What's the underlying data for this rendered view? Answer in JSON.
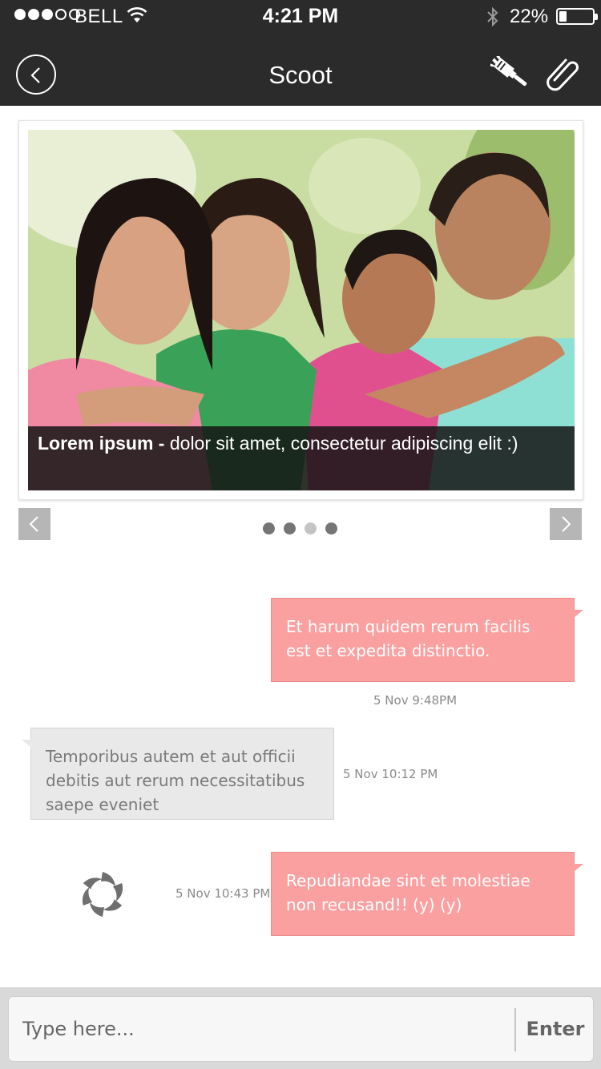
{
  "status_bar": {
    "carrier": "BELL",
    "time": "4:21 PM",
    "battery_percent": "22%",
    "battery_level": 0.22,
    "signal_bars_filled": 3,
    "signal_bars_total": 5,
    "icons": [
      "wifi-icon",
      "bluetooth-icon",
      "battery-icon"
    ]
  },
  "nav": {
    "title": "Scoot",
    "icons": [
      "back-icon",
      "brush-icon",
      "paperclip-icon"
    ]
  },
  "carousel": {
    "caption_bold": "Lorem ipsum -",
    "caption_text": " dolor sit amet, consectetur adipiscing elit :)",
    "pages_total": 4,
    "active_page": 3,
    "icons": [
      "chevron-left-icon",
      "chevron-right-icon"
    ]
  },
  "messages": [
    {
      "direction": "out",
      "text": "Et harum quidem rerum facilis est et expedita distinctio.",
      "timestamp": "5 Nov 9:48PM"
    },
    {
      "direction": "in",
      "text": "Temporibus autem et aut officii debitis aut rerum necessitatibus saepe eveniet",
      "timestamp": "5 Nov 10:12 PM"
    },
    {
      "direction": "out",
      "text": "Repudiandae sint et molestiae non recusand!! (y) (y)",
      "timestamp": "5 Nov 10:43 PM"
    }
  ],
  "composer": {
    "placeholder": "Type here...",
    "value": "",
    "send_label": "Enter"
  },
  "colors": {
    "topbar": "#2b2b2b",
    "outgoing_bubble": "#fba0a0",
    "incoming_bubble": "#e9e9e9",
    "input_bar": "#d9d9d9"
  }
}
